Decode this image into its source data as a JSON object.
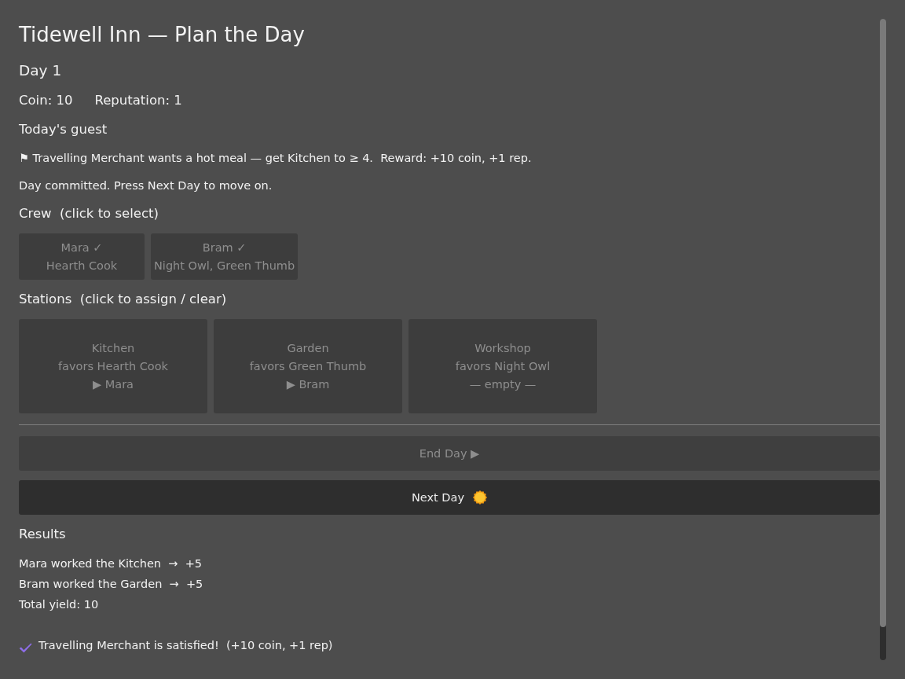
{
  "title": "Tidewell Inn — Plan the Day",
  "day": "Day 1",
  "stats": [
    "Coin: 10",
    "Reputation: 1"
  ],
  "guest": {
    "heading": "Today's guest",
    "request": "⚑ Travelling Merchant wants a hot meal — get Kitchen to ≥ 4.  Reward: +10 coin, +1 rep."
  },
  "status_message": "Day committed. Press Next Day to move on.",
  "crew": {
    "heading": "Crew  (click to select)",
    "members": [
      {
        "name": "Mara ✓",
        "traits": "Hearth Cook",
        "disabled": true
      },
      {
        "name": "Bram ✓",
        "traits": "Night Owl, Green Thumb",
        "disabled": true
      }
    ]
  },
  "stations": {
    "heading": "Stations  (click to assign / clear)",
    "items": [
      {
        "name": "Kitchen",
        "favors": "favors Hearth Cook",
        "assignee": "▶ Mara",
        "disabled": true
      },
      {
        "name": "Garden",
        "favors": "favors Green Thumb",
        "assignee": "▶ Bram",
        "disabled": true
      },
      {
        "name": "Workshop",
        "favors": "favors Night Owl",
        "assignee": "— empty —",
        "disabled": true
      }
    ]
  },
  "actions": [
    {
      "label": "End Day ▶",
      "kind": "plain",
      "disabled": true
    },
    {
      "label": "Next Day",
      "kind": "with-icon",
      "disabled": false
    }
  ],
  "results": {
    "heading": "Results",
    "lines": [
      "Mara worked the Kitchen  →  +5",
      "Bram worked the Garden  →  +5",
      "Total yield: 10"
    ],
    "outcome": {
      "text": "Travelling Merchant is satisfied!  (+10 coin, +1 rep)",
      "satisfied": true
    }
  }
}
